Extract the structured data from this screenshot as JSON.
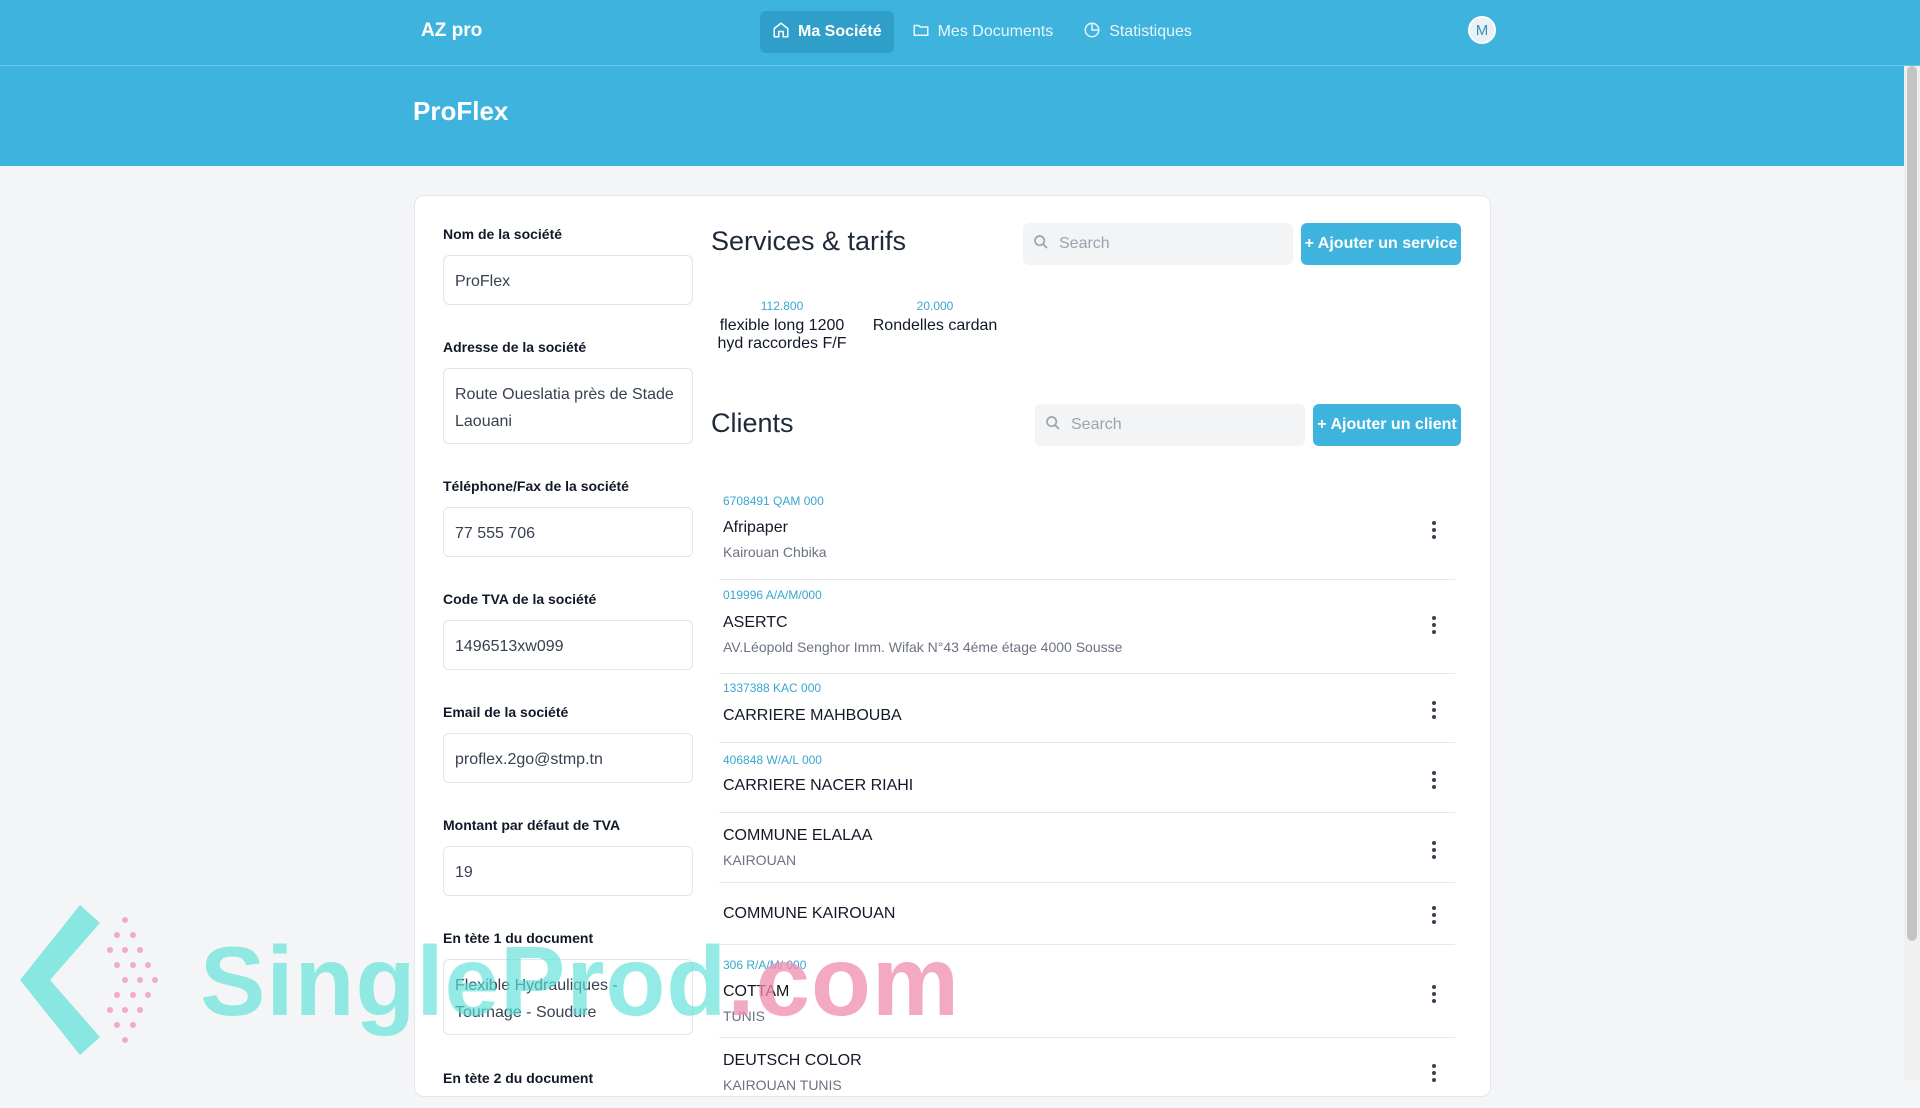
{
  "nav": {
    "brand": "AZ pro",
    "links": [
      {
        "label": "Ma Société",
        "icon": "home-icon",
        "active": true
      },
      {
        "label": "Mes Documents",
        "icon": "folder-icon",
        "active": false
      },
      {
        "label": "Statistiques",
        "icon": "pie-chart-icon",
        "active": false
      }
    ],
    "avatar": "M"
  },
  "banner": {
    "title": "ProFlex"
  },
  "form": {
    "fields": [
      {
        "label": "Nom de la société",
        "value": "ProFlex"
      },
      {
        "label": "Adresse de la société",
        "value": "Route Oueslatia près de Stade Laouani"
      },
      {
        "label": "Téléphone/Fax de la société",
        "value": "77 555 706"
      },
      {
        "label": "Code TVA de la société",
        "value": "1496513xw099"
      },
      {
        "label": "Email de la société",
        "value": "proflex.2go@stmp.tn"
      },
      {
        "label": "Montant par défaut de TVA",
        "value": "19"
      },
      {
        "label": "En tète 1 du document",
        "value": "Flexible Hydrauliques - Tournage - Soudure"
      },
      {
        "label": "En tète 2 du document",
        "value": ""
      }
    ]
  },
  "services": {
    "title": "Services & tarifs",
    "search_placeholder": "Search",
    "add_label": "+ Ajouter un service",
    "items": [
      {
        "price": "112.800",
        "name": "flexible long 1200 hyd raccordes F/F"
      },
      {
        "price": "20.000",
        "name": "Rondelles cardan"
      }
    ]
  },
  "clients": {
    "title": "Clients",
    "search_placeholder": "Search",
    "add_label": "+ Ajouter un client",
    "items": [
      {
        "code": "6708491 QAM 000",
        "name": "Afripaper",
        "sub": "Kairouan Chbika"
      },
      {
        "code": "019996 A/A/M/000",
        "name": "ASERTC",
        "sub": "AV.Léopold Senghor Imm. Wifak N°43 4éme étage 4000 Sousse"
      },
      {
        "code": "1337388 KAC 000",
        "name": "CARRIERE MAHBOUBA",
        "sub": ""
      },
      {
        "code": "406848 W/A/L 000",
        "name": "CARRIERE NACER RIAHI",
        "sub": ""
      },
      {
        "code": "",
        "name": "COMMUNE ELALAA",
        "sub": "KAIROUAN"
      },
      {
        "code": "",
        "name": "COMMUNE KAIROUAN",
        "sub": ""
      },
      {
        "code": "306 R/A/M/ 000",
        "name": "COTTAM",
        "sub": "TUNIS"
      },
      {
        "code": "",
        "name": "DEUTSCH COLOR",
        "sub": "KAIROUAN TUNIS"
      }
    ]
  },
  "watermark": {
    "text_main": "SingleProd",
    "text_tld": ".com"
  },
  "colors": {
    "primary": "#3db3de",
    "accent_text": "#3aa6d0"
  }
}
